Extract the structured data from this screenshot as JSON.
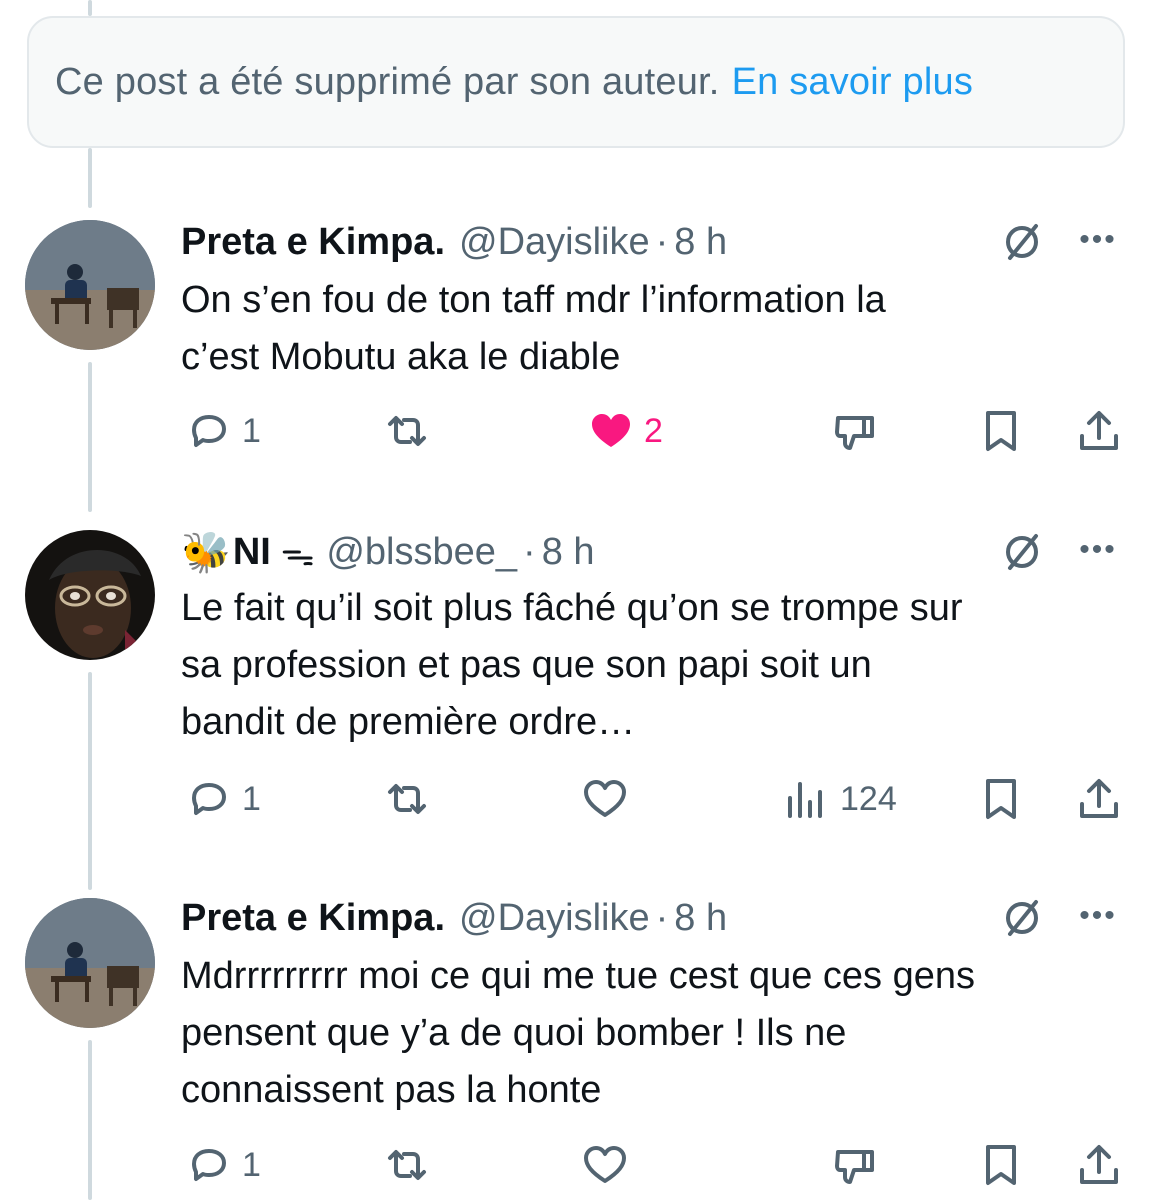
{
  "deleted_notice": {
    "text": "Ce post a été supprimé par son auteur.",
    "link": "En savoir plus"
  },
  "posts": [
    {
      "name": "Preta e Kimpa.",
      "handle": "@Dayislike",
      "separator": "·",
      "time": "8 h",
      "lines": [
        "On s’en fou de ton taff mdr l’information la",
        "c’est Mobutu aka le diable"
      ],
      "replies": "1",
      "likes": "2",
      "liked": true,
      "fourth_action": "dislike-icon"
    },
    {
      "name_emoji": "🐝",
      "name": "NI",
      "name_suffix": "ᯓ",
      "handle": "@blssbee_",
      "separator": "·",
      "time": "8 h",
      "lines": [
        "Le fait qu’il soit plus fâché qu’on se trompe sur",
        "sa profession et pas que son papi soit un",
        "bandit de première ordre…"
      ],
      "replies": "1",
      "likes": "",
      "liked": false,
      "views": "124",
      "fourth_action": "views-icon"
    },
    {
      "name": "Preta e Kimpa.",
      "handle": "@Dayislike",
      "separator": "·",
      "time": "8 h",
      "lines": [
        "Mdrrrrrrrrr moi ce qui me tue cest que ces gens",
        "pensent que y’a de quoi bomber ! Ils ne",
        "connaissent pas la honte"
      ],
      "replies": "1",
      "likes": "",
      "liked": false,
      "fourth_action": "dislike-icon"
    }
  ],
  "colors": {
    "accent_link": "#1d9bf0",
    "like_active": "#f91880",
    "muted": "#536471",
    "thread_line": "#cfd9de"
  }
}
